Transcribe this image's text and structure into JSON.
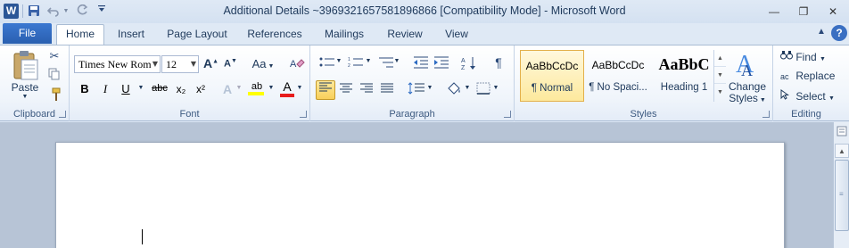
{
  "app": {
    "title": "Additional Details ~3969321657581896866 [Compatibility Mode]  -  Microsoft Word",
    "logo_letter": "W"
  },
  "qat": {
    "save_icon": "floppy-disk",
    "undo_icon": "undo-arrow",
    "redo_icon": "redo-arrow",
    "customize_icon": "dropdown"
  },
  "window_controls": {
    "minimize": "—",
    "restore": "❐",
    "close": "✕"
  },
  "tabs": {
    "file": "File",
    "items": [
      "Home",
      "Insert",
      "Page Layout",
      "References",
      "Mailings",
      "Review",
      "View"
    ],
    "active": "Home",
    "help": "?"
  },
  "clipboard": {
    "paste_label": "Paste",
    "group_label": "Clipboard"
  },
  "font": {
    "family": "Times New Rom",
    "size": "12",
    "group_label": "Font",
    "bold": "B",
    "italic": "I",
    "underline": "U",
    "strikethrough": "abc",
    "subscript": "x₂",
    "superscript": "x²",
    "grow": "A",
    "shrink": "A",
    "change_case": "Aa",
    "text_effects": "A",
    "highlight": "ab",
    "font_color": "A",
    "highlight_color": "#ffff00",
    "font_color_value": "#e81c1c"
  },
  "paragraph": {
    "group_label": "Paragraph",
    "pilcrow": "¶"
  },
  "styles": {
    "group_label": "Styles",
    "items": [
      {
        "preview": "AaBbCcDc",
        "name": "¶ Normal"
      },
      {
        "preview": "AaBbCcDc",
        "name": "¶ No Spaci..."
      },
      {
        "preview": "AaBbC",
        "name": "Heading 1"
      }
    ],
    "change_styles_label_1": "Change",
    "change_styles_label_2": "Styles"
  },
  "editing": {
    "group_label": "Editing",
    "find": "Find",
    "replace": "Replace",
    "select": "Select"
  }
}
